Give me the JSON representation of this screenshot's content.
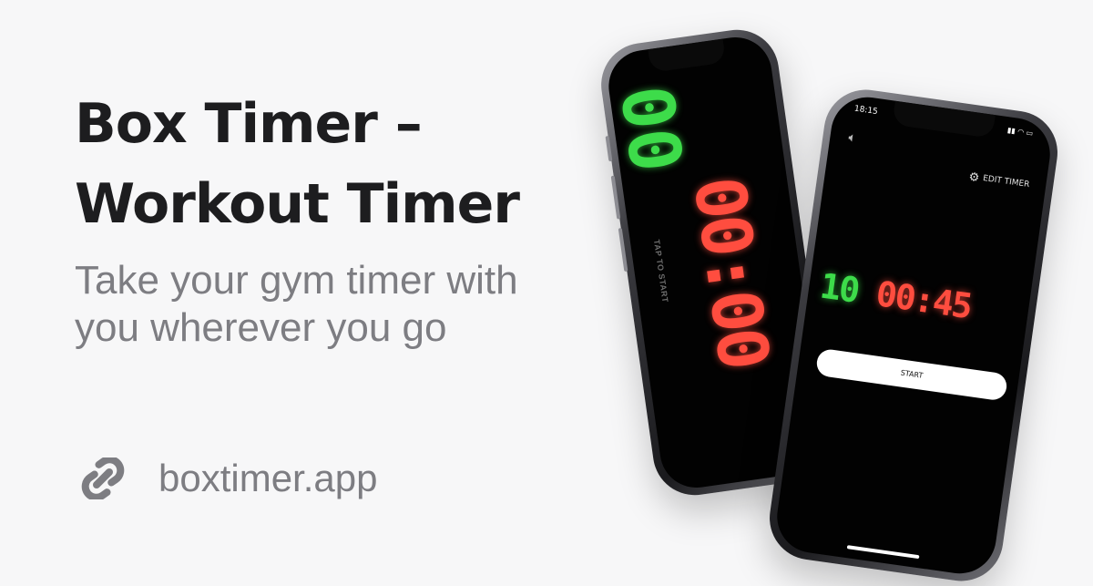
{
  "headline": {
    "line1": "Box Timer –",
    "line2": "Workout Timer"
  },
  "tagline": {
    "line1": "Take your gym timer with",
    "line2": "you wherever you go"
  },
  "link": {
    "icon": "link-icon",
    "url_text": "boxtimer.app"
  },
  "phone_landscape": {
    "rounds": "00",
    "time": "00:00",
    "tap_text": "TAP TO START"
  },
  "phone_portrait": {
    "status_time": "18:15",
    "edit_label": "EDIT TIMER",
    "rounds": "10",
    "time_mm": "00",
    "time_ss": "45",
    "start_label": "START"
  },
  "colors": {
    "green": "#3ddc4a",
    "red": "#ff4d3f",
    "text_dark": "#1d1d1f",
    "text_gray": "#7d7d82"
  }
}
